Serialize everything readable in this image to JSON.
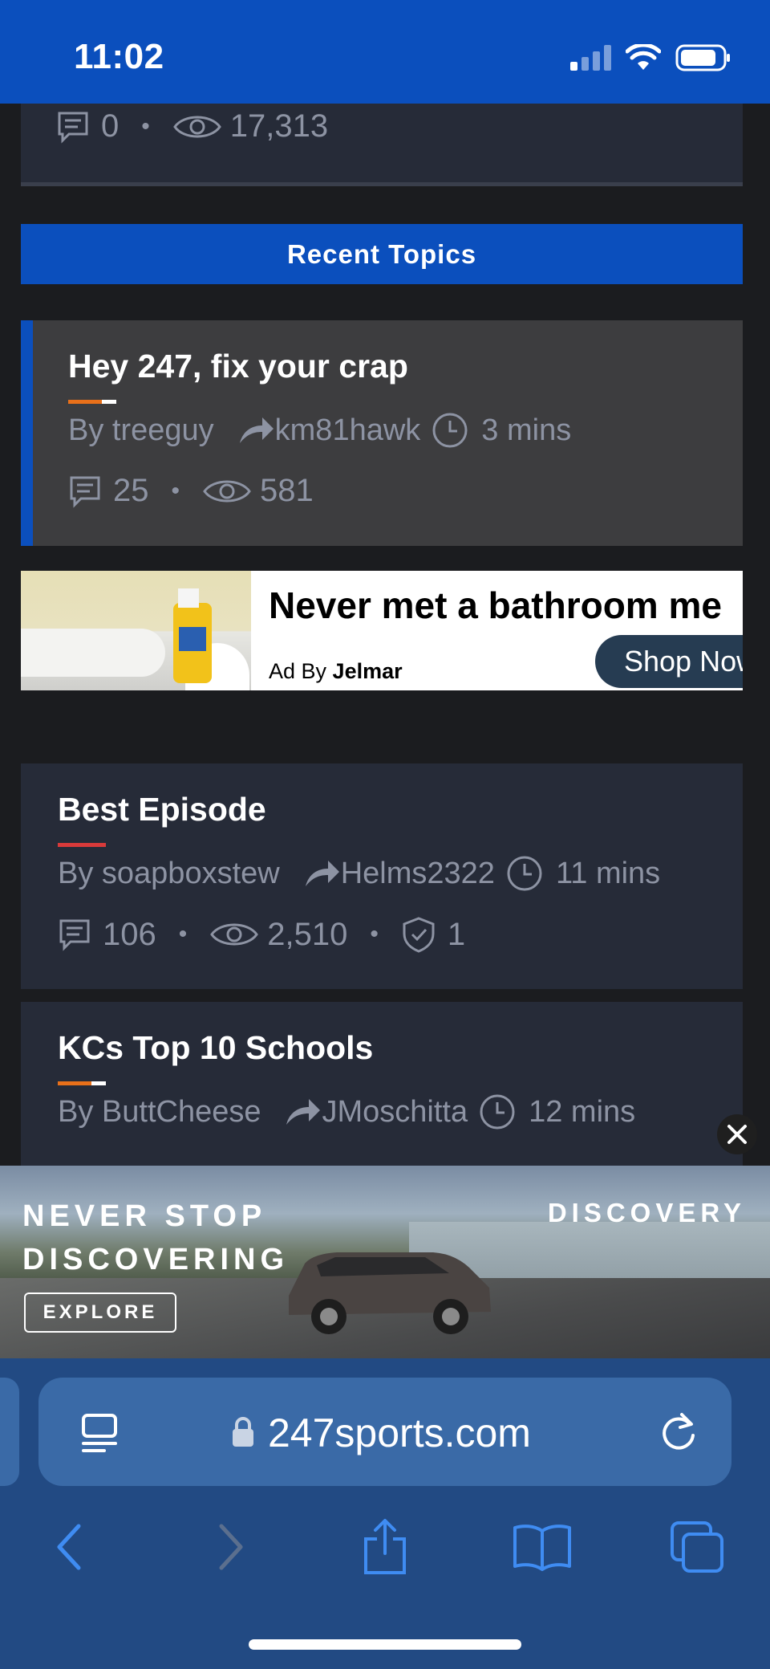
{
  "status_bar": {
    "time": "11:02"
  },
  "top_card": {
    "comments": "0",
    "views": "17,313"
  },
  "recent_topics": {
    "header": "Recent Topics"
  },
  "topics": [
    {
      "title": "Hey 247, fix your crap",
      "by": "By treeguy",
      "last_reply": "km81hawk",
      "time": "3 mins",
      "comments": "25",
      "views": "581",
      "underline_colors": [
        "#e8701a",
        "#ffffff"
      ]
    },
    {
      "title": "Best Episode",
      "by": "By soapboxstew",
      "last_reply": "Helms2322",
      "time": "11 mins",
      "comments": "106",
      "views": "2,510",
      "shield": "1",
      "underline_colors": [
        "#d93a3a",
        "#d93a3a"
      ]
    },
    {
      "title": "KCs Top 10 Schools",
      "by": "By ButtCheese",
      "last_reply": "JMoschitta",
      "time": "12 mins",
      "underline_colors": [
        "#e8701a",
        "#ffffff"
      ]
    }
  ],
  "ad_bathroom": {
    "headline": "Never met a bathroom me",
    "by_prefix": "Ad By ",
    "advertiser": "Jelmar",
    "cta": "Shop Now"
  },
  "ad_car": {
    "tagline_line1": "NEVER STOP",
    "tagline_line2": "DISCOVERING",
    "brand": "DISCOVERY",
    "cta": "EXPLORE"
  },
  "browser": {
    "url": "247sports.com"
  },
  "colors": {
    "accent_blue": "#0b4fbd",
    "card_bg": "#262b38",
    "highlight_card_bg": "#3d3d3f"
  }
}
